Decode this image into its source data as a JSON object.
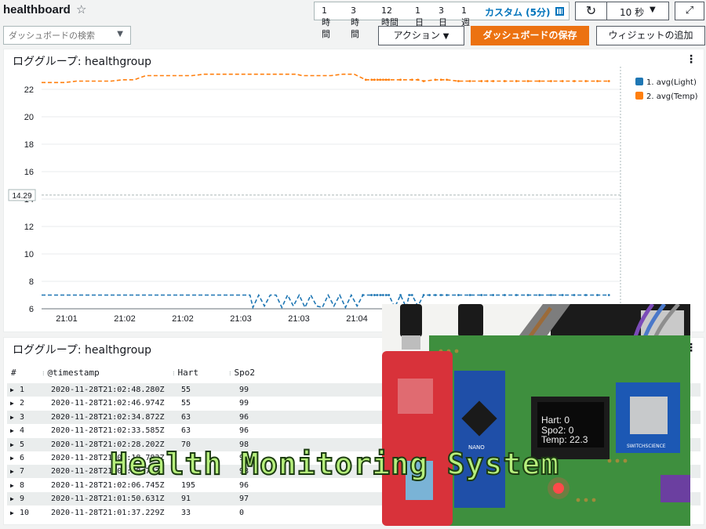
{
  "header": {
    "dashboard_title": "healthboard",
    "search_placeholder": "ダッシュボードの検索",
    "time_ranges": [
      {
        "label": "1時間"
      },
      {
        "label": "3時間"
      },
      {
        "label": "12時間"
      },
      {
        "label": "1日"
      },
      {
        "label": "3日"
      },
      {
        "label": "1週"
      }
    ],
    "custom_range": "カスタム (5分)",
    "refresh_interval": "10 秒",
    "actions_label": "アクション",
    "save_label": "ダッシュボードの保存",
    "add_widget_label": "ウィジェットの追加",
    "icons": [
      "star-icon",
      "search-dropdown-icon",
      "calendar-icon",
      "refresh-icon",
      "dropdown-icon",
      "fullscreen-icon",
      "more-menu-icon",
      "expand-row-icon"
    ]
  },
  "chart_widget": {
    "title": "ロググループ: healthgroup",
    "menu_glyph": "⋮",
    "legend": [
      {
        "label": "1. avg(Light)",
        "color": "#1f77b4"
      },
      {
        "label": "2. avg(Temp)",
        "color": "#ff7f0e"
      }
    ]
  },
  "chart_data": {
    "type": "line",
    "y_ticks": [
      "6",
      "8",
      "10",
      "12",
      "14",
      "16",
      "18",
      "20",
      "22"
    ],
    "ylim": [
      6,
      23.2
    ],
    "x_ticks": [
      "21:01",
      "21:02",
      "21:02",
      "21:03",
      "21:03",
      "21:04"
    ],
    "xlim": [
      0,
      100
    ],
    "marker_label": "14.29",
    "marker_value": 14.29,
    "grid": true,
    "legend_position": "right",
    "series": [
      {
        "name": "1. avg(Light)",
        "color": "#1f77b4",
        "x": [
          0,
          2,
          4,
          6,
          8,
          10,
          12,
          14,
          16,
          18,
          20,
          22,
          24,
          26,
          28,
          30,
          32,
          34,
          36,
          36.5,
          37.5,
          38.5,
          39.5,
          40.5,
          41.5,
          42.5,
          43.5,
          44.5,
          45.5,
          46.5,
          47.5,
          48.5,
          49.5,
          50.5,
          51.5,
          52.5,
          53.5,
          54.5,
          55.5,
          57,
          57.5,
          58,
          58.5,
          59,
          59.5,
          60,
          61,
          62,
          63,
          63.5,
          64,
          65,
          66,
          67,
          68,
          69,
          70,
          72,
          74,
          76,
          78,
          80,
          82,
          84,
          86,
          88,
          90,
          92,
          94,
          96,
          98
        ],
        "y": [
          7,
          7,
          7,
          7,
          7,
          7,
          7,
          7,
          7,
          7,
          7,
          7,
          7,
          7,
          7,
          7,
          7,
          7,
          7,
          6.1,
          7,
          6.2,
          7,
          7,
          6.1,
          7,
          6.2,
          7,
          6.1,
          7,
          6.2,
          6.1,
          7,
          6.2,
          7,
          6.1,
          7,
          6.2,
          7,
          7,
          7,
          7,
          7,
          7,
          7,
          7,
          6.1,
          7,
          6.1,
          7,
          7,
          6.2,
          7,
          7,
          7,
          7,
          7,
          7,
          7,
          7,
          7,
          7,
          7,
          7,
          7,
          7,
          7,
          7,
          7,
          7,
          7
        ]
      },
      {
        "name": "2. avg(Temp)",
        "color": "#ff7f0e",
        "x": [
          0,
          2,
          4,
          6,
          8,
          10,
          12,
          14,
          16,
          18,
          20,
          22,
          24,
          26,
          28,
          30,
          32,
          34,
          36,
          38,
          40,
          42,
          44,
          45,
          46,
          48,
          50,
          52,
          54,
          56,
          57,
          57.5,
          58,
          58.5,
          59,
          59.5,
          60,
          62,
          64,
          65,
          66,
          68,
          69,
          70,
          72,
          74,
          76,
          77,
          78,
          80,
          82,
          84,
          86,
          88,
          90,
          92,
          94,
          96,
          98
        ],
        "y": [
          22.5,
          22.5,
          22.5,
          22.6,
          22.6,
          22.6,
          22.6,
          22.7,
          22.7,
          23,
          23,
          23,
          23,
          23,
          23.1,
          23.1,
          23.1,
          23.1,
          23.1,
          23.1,
          23.1,
          23.1,
          23.1,
          23,
          23,
          23,
          23,
          23.1,
          23.1,
          22.7,
          22.7,
          22.7,
          22.7,
          22.7,
          22.7,
          22.7,
          22.7,
          22.7,
          22.7,
          22.7,
          22.6,
          22.7,
          22.7,
          22.7,
          22.6,
          22.6,
          22.6,
          22.6,
          22.6,
          22.6,
          22.6,
          22.6,
          22.6,
          22.6,
          22.6,
          22.6,
          22.6,
          22.6,
          22.6
        ]
      }
    ]
  },
  "table_widget": {
    "title": "ロググループ: healthgroup",
    "menu_glyph": "⋮",
    "columns": [
      "#",
      "@timestamp",
      "Hart",
      "Spo2"
    ],
    "rows": [
      {
        "n": "1",
        "timestamp": "2020-11-28T21:02:48.280Z",
        "hart": "55",
        "spo2": "99"
      },
      {
        "n": "2",
        "timestamp": "2020-11-28T21:02:46.974Z",
        "hart": "55",
        "spo2": "99"
      },
      {
        "n": "3",
        "timestamp": "2020-11-28T21:02:34.872Z",
        "hart": "63",
        "spo2": "96"
      },
      {
        "n": "4",
        "timestamp": "2020-11-28T21:02:33.585Z",
        "hart": "63",
        "spo2": "96"
      },
      {
        "n": "5",
        "timestamp": "2020-11-28T21:02:28.202Z",
        "hart": "70",
        "spo2": "98"
      },
      {
        "n": "6",
        "timestamp": "2020-11-28T21:02:18.782Z",
        "hart": "",
        "spo2": "98"
      },
      {
        "n": "7",
        "timestamp": "2020-11-28T21:02:18.782Z",
        "hart": "",
        "spo2": "98"
      },
      {
        "n": "8",
        "timestamp": "2020-11-28T21:02:06.745Z",
        "hart": "195",
        "spo2": "96"
      },
      {
        "n": "9",
        "timestamp": "2020-11-28T21:01:50.631Z",
        "hart": "91",
        "spo2": "97"
      },
      {
        "n": "10",
        "timestamp": "2020-11-28T21:01:37.229Z",
        "hart": "33",
        "spo2": "0"
      }
    ]
  },
  "photo_overlay": {
    "oled_lines": [
      "Hart:  0",
      "Spo2:  0",
      "Temp:  22.3"
    ],
    "caption": "Health Monitoring System",
    "board_labels": [
      "NANO",
      "SWITCHSCIENCE"
    ]
  }
}
